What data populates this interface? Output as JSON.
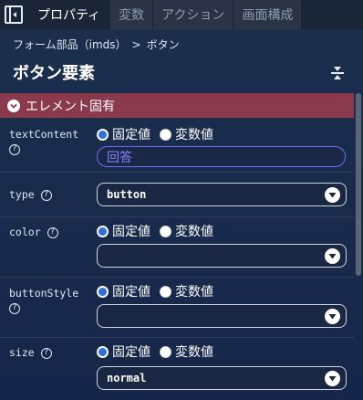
{
  "tabs": [
    {
      "label": "プロパティ",
      "active": true
    },
    {
      "label": "変数",
      "active": false
    },
    {
      "label": "アクション",
      "active": false
    },
    {
      "label": "画面構成",
      "active": false
    }
  ],
  "breadcrumb": {
    "parent": "フォーム部品（imds）",
    "separator": ">",
    "current": "ボタン"
  },
  "title": "ボタン要素",
  "section": {
    "label": "エレメント固有"
  },
  "radio_labels": {
    "fixed": "固定値",
    "variable": "変数値"
  },
  "help_icon": "?",
  "props": {
    "textContent": {
      "label": "textContent",
      "mode": "fixed",
      "value": "回答"
    },
    "type": {
      "label": "type",
      "value": "button"
    },
    "color": {
      "label": "color",
      "mode": "fixed",
      "value": ""
    },
    "buttonStyle": {
      "label": "buttonStyle",
      "mode": "fixed",
      "value": ""
    },
    "size": {
      "label": "size",
      "mode": "fixed",
      "value": "normal"
    }
  },
  "colors": {
    "accent_radio": "#2b6fe0",
    "section_header": "#8a3a4c",
    "text_field_border": "#6d6cf0"
  }
}
